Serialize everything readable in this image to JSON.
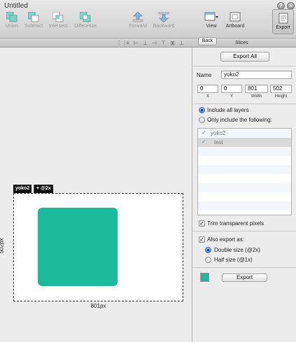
{
  "window": {
    "title": "Untitled"
  },
  "toolbar": {
    "tools": [
      {
        "key": "union",
        "label": "Union"
      },
      {
        "key": "subtract",
        "label": "Subtract"
      },
      {
        "key": "intersect",
        "label": "Intersect"
      },
      {
        "key": "difference",
        "label": "Difference"
      },
      {
        "key": "forward",
        "label": "Forward"
      },
      {
        "key": "backward",
        "label": "Backward"
      },
      {
        "key": "view",
        "label": "View"
      },
      {
        "key": "artboard",
        "label": "Artboard"
      }
    ],
    "export_label": "Export",
    "help_icon": "help-icon",
    "close_icon": "close-icon"
  },
  "subbar": {
    "back_label": "Back",
    "title": "Slices"
  },
  "canvas": {
    "slice_name": "yoko2",
    "slice_badge": "+ @2x",
    "width_label": "801px",
    "height_label": "502px",
    "shape_color": "#1abc9c"
  },
  "inspector": {
    "export_all_label": "Export All",
    "name_label": "Name",
    "name_value": "yoko2",
    "x_value": "0",
    "x_label": "X",
    "y_value": "0",
    "y_label": "Y",
    "width_value": "801",
    "width_label": "Width",
    "height_value": "502",
    "height_label": "Height",
    "include_all_label": "Include all layers",
    "only_include_label": "Only include the following:",
    "layers": [
      {
        "name": "yoko2",
        "checked": true
      },
      {
        "name": "test",
        "checked": true
      }
    ],
    "trim_label": "Trim transparent pixels",
    "also_export_label": "Also export as:",
    "double_label": "Double size (@2x)",
    "half_label": "Half size (@1x)",
    "swatch_color": "#1abc9c",
    "export_label": "Export"
  }
}
